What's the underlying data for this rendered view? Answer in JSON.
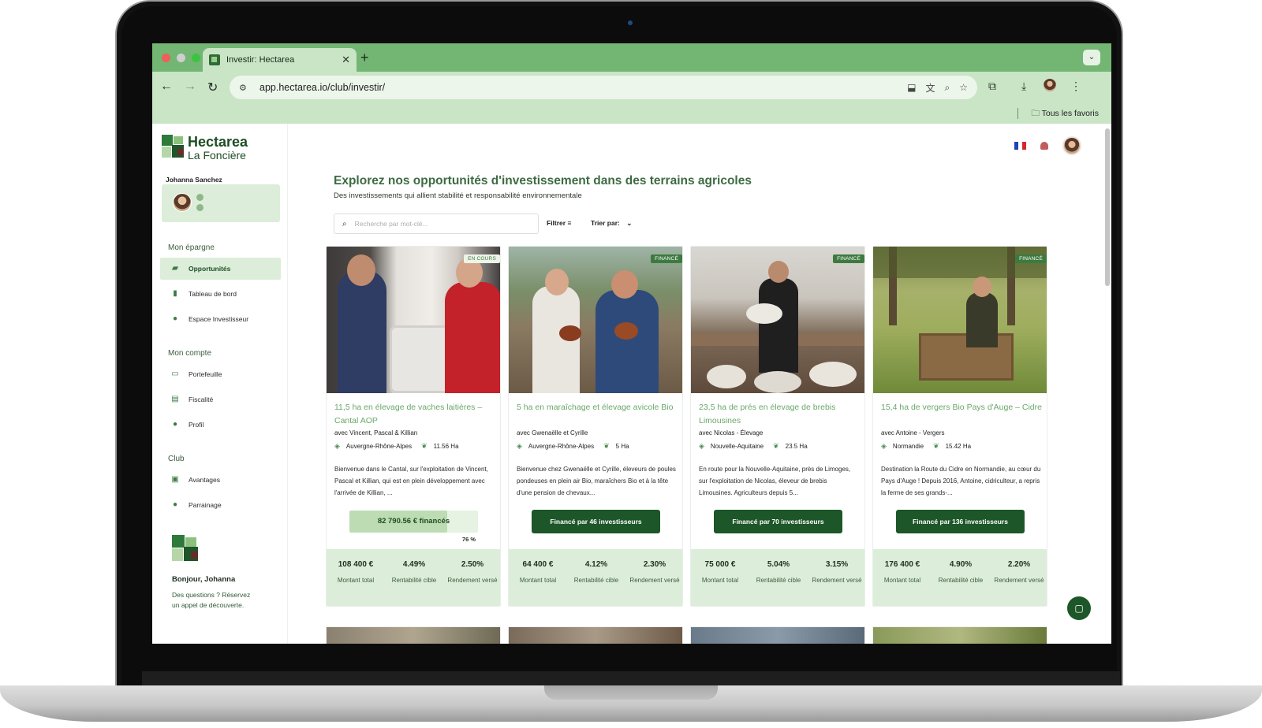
{
  "browser": {
    "tab_title": "Investir: Hectarea",
    "url": "app.hectarea.io/club/investir/",
    "bookmarks_folder": "Tous les favoris"
  },
  "brand": {
    "line1": "Hectarea",
    "line2": "La Foncière"
  },
  "user": {
    "name": "Johanna Sanchez"
  },
  "sidebar": {
    "section_savings": "Mon épargne",
    "items_savings": [
      {
        "label": "Opportunités",
        "icon": "opportunities-icon"
      },
      {
        "label": "Tableau de bord",
        "icon": "bar-chart-icon"
      },
      {
        "label": "Espace Investisseur",
        "icon": "investor-icon"
      }
    ],
    "section_account": "Mon compte",
    "items_account": [
      {
        "label": "Portefeuille",
        "icon": "wallet-icon"
      },
      {
        "label": "Fiscalité",
        "icon": "document-icon"
      },
      {
        "label": "Profil",
        "icon": "user-icon"
      }
    ],
    "section_club": "Club",
    "items_club": [
      {
        "label": "Avantages",
        "icon": "gift-icon"
      },
      {
        "label": "Parrainage",
        "icon": "referral-icon"
      }
    ],
    "greeting": "Bonjour, Johanna",
    "help_text": "Des questions ? Réservez un appel de découverte."
  },
  "main": {
    "title": "Explorez nos opportunités d'investissement dans des terrains agricoles",
    "subtitle": "Des investissements qui allient stabilité et responsabilité environnementale",
    "search_placeholder": "Recherche par mot-clé...",
    "filter_label": "Filtrer",
    "sort_label": "Trier par:"
  },
  "cards": [
    {
      "badge": "EN COURS",
      "title": "11,5 ha en élevage de vaches laitières – Cantal AOP",
      "with": "avec Vincent, Pascal & Killian",
      "region": "Auvergne-Rhône-Alpes",
      "area": "11.56 Ha",
      "description": "Bienvenue dans le Cantal, sur l'exploitation de Vincent, Pascal et Killian, qui est en plein développement avec l'arrivée de Killian, ...",
      "progress_label": "82 790.56 € financés",
      "progress": 0.76,
      "progress_pct": "76 %",
      "stats": [
        {
          "value": "108 400 €",
          "label": "Montant total"
        },
        {
          "value": "4.49%",
          "label": "Rentabilité cible"
        },
        {
          "value": "2.50%",
          "label": "Rendement versé"
        }
      ]
    },
    {
      "badge": "FINANCÉ",
      "title": "5 ha en maraîchage et élevage avicole Bio",
      "with": "avec Gwenaëlle et Cyrille",
      "region": "Auvergne-Rhône-Alpes",
      "area": "5 Ha",
      "description": "Bienvenue chez Gwenaëlle et Cyrille, éleveurs de poules pondeuses en plein air Bio, maraîchers Bio et à la tête d'une pension de chevaux...",
      "button_label": "Financé par 46 investisseurs",
      "stats": [
        {
          "value": "64 400 €",
          "label": "Montant total"
        },
        {
          "value": "4.12%",
          "label": "Rentabilité cible"
        },
        {
          "value": "2.30%",
          "label": "Rendement versé"
        }
      ]
    },
    {
      "badge": "FINANCÉ",
      "title": "23,5 ha de prés en élevage de brebis Limousines",
      "with": "avec Nicolas - Élevage",
      "region": "Nouvelle-Aquitaine",
      "area": "23.5 Ha",
      "description": "En route pour la Nouvelle-Aquitaine, près de Limoges, sur l'exploitation de Nicolas, éleveur de brebis Limousines. Agriculteurs depuis 5...",
      "button_label": "Financé par 70 investisseurs",
      "stats": [
        {
          "value": "75 000 €",
          "label": "Montant total"
        },
        {
          "value": "5.04%",
          "label": "Rentabilité cible"
        },
        {
          "value": "3.15%",
          "label": "Rendement versé"
        }
      ]
    },
    {
      "badge": "FINANCÉ",
      "title": "15,4 ha de vergers Bio Pays d'Auge – Cidre",
      "with": "avec Antoine - Vergers",
      "region": "Normandie",
      "area": "15.42 Ha",
      "description": "Destination la Route du Cidre en Normandie, au cœur du Pays d'Auge ! Depuis 2016, Antoine, cidriculteur, a repris la ferme de ses grands-...",
      "button_label": "Financé par 136 investisseurs",
      "stats": [
        {
          "value": "176 400 €",
          "label": "Montant total"
        },
        {
          "value": "4.90%",
          "label": "Rentabilité cible"
        },
        {
          "value": "2.20%",
          "label": "Rendement versé"
        }
      ]
    }
  ],
  "colors": {
    "brand_dark": "#1d5628",
    "brand_light": "#dceed9",
    "accent_text": "#6aa86a",
    "browser_frame": "#73b573"
  }
}
